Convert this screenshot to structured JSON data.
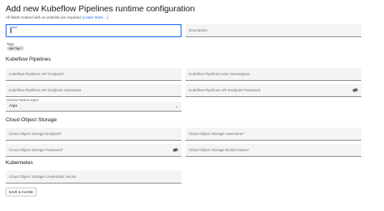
{
  "header": {
    "title": "Add new Kubeflow Pipelines runtime configuration",
    "note_prefix": "All fields marked with an asterisk are required.",
    "learn_more": "[Learn more ...]"
  },
  "general": {
    "name_label": "Name*",
    "name_value": "",
    "description_placeholder": "Description",
    "tags_label": "Tags",
    "add_tag": "Add Tag +"
  },
  "kfp": {
    "section_title": "Kubeflow Pipelines",
    "api_endpoint": "Kubeflow Pipelines API Endpoint*",
    "namespace": "Kubeflow Pipelines User Namespace",
    "api_username": "Kubeflow Pipelines API Endpoint Username",
    "api_password": "Kubeflow Pipelines API Endpoint Password",
    "engine_label": "Kubeflow Pipelines engine",
    "engine_value": "Argo"
  },
  "cos": {
    "section_title": "Cloud Object Storage",
    "endpoint": "Cloud Object Storage Endpoint*",
    "username": "Cloud Object Storage Username*",
    "password": "Cloud Object Storage Password*",
    "bucket": "Cloud Object Storage Bucket Name*"
  },
  "kubernetes": {
    "section_title": "Kubernetes",
    "credentials_secret": "Cloud Object Storage Credentials Secret"
  },
  "actions": {
    "save_close": "SAVE & CLOSE"
  },
  "icons": {
    "password_toggle": "eye-icon",
    "dropdown": "chevron-down-icon"
  }
}
